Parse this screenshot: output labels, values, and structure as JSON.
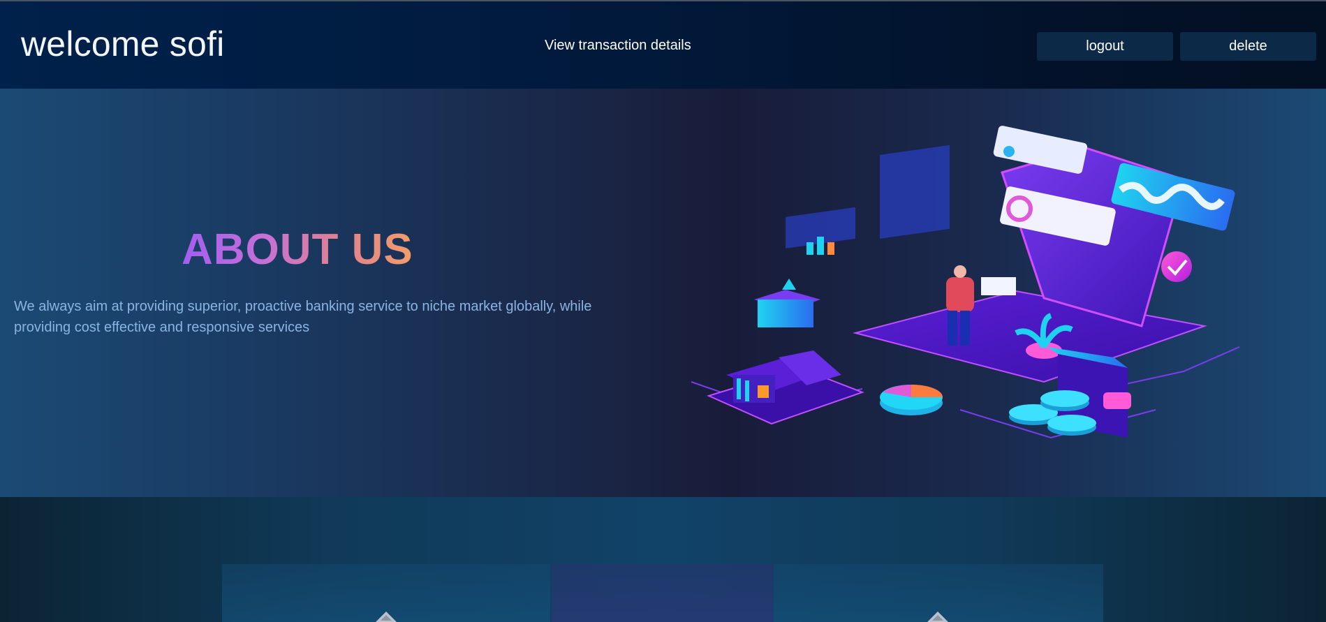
{
  "navbar": {
    "brand": "welcome sofi",
    "link": "View transaction details",
    "buttons": {
      "logout": "logout",
      "delete": "delete"
    }
  },
  "about": {
    "title": "ABOUT US",
    "text": "We always aim at providing superior, proactive banking service to niche market globally, while providing cost effective and responsive services"
  },
  "icons": {
    "illustration": "isometric-banking-illustration",
    "card_icon": "house-icon"
  },
  "colors": {
    "navbar_bg": "#01193a",
    "button_bg": "#0c2a48",
    "title_gradient_start": "#a25ef0",
    "title_gradient_end": "#f29d6b",
    "about_text": "#8ab5e3"
  }
}
